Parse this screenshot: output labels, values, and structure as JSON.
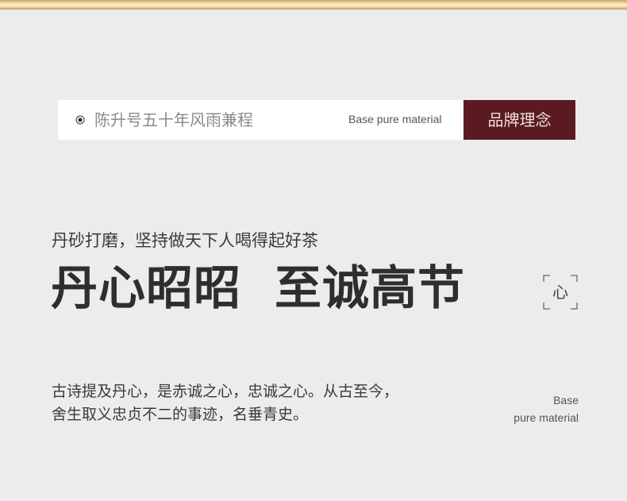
{
  "band": {
    "text": "陈升号五十年风雨兼程",
    "subtitle": "Base pure material",
    "button_label": "品牌理念",
    "accent_color": "#5b1a22",
    "icon": "bullet-dot-icon"
  },
  "hero": {
    "kicker": "丹砂打磨，坚持做天下人喝得起好茶",
    "headline_part1": "丹心昭昭",
    "headline_part2": "至诚高节",
    "seal_char": "心"
  },
  "body": {
    "line1": "古诗提及丹心，是赤诚之心，忠诚之心。从古至今，",
    "line2": "舍生取义忠贞不二的事迹，名垂青史。"
  },
  "side_note": {
    "line1": "Base",
    "line2": "pure material"
  },
  "colors": {
    "background": "#ececec",
    "gold_strip": "#e7c98d",
    "text_dark": "#2e2e2e"
  }
}
